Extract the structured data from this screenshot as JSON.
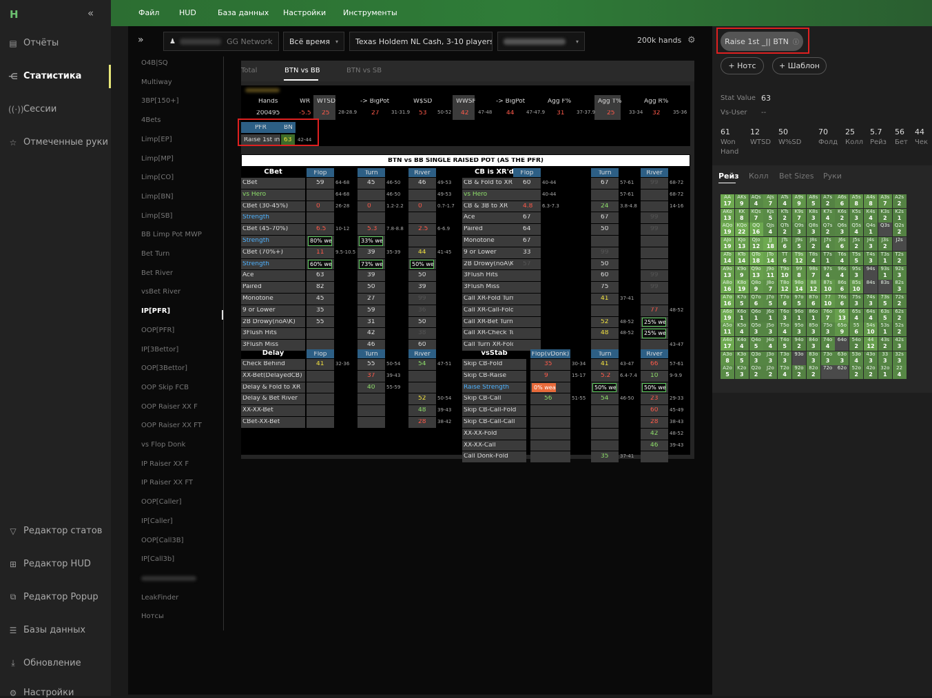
{
  "app": {
    "logo": "H",
    "collapse": "«"
  },
  "nav": [
    {
      "label": "Отчёты",
      "icon": "report-icon",
      "glyph": "▤"
    },
    {
      "label": "Статистика",
      "icon": "stats-icon",
      "glyph": "⋲",
      "active": true
    },
    {
      "label": "Сессии",
      "icon": "sessions-icon",
      "glyph": "((·))"
    },
    {
      "label": "Отмеченные руки",
      "icon": "star-icon",
      "glyph": "☆"
    },
    {
      "label": "Редактор статов",
      "icon": "filter-icon",
      "glyph": "▽"
    },
    {
      "label": "Редактор HUD",
      "icon": "hud-icon",
      "glyph": "⊞"
    },
    {
      "label": "Редактор Popup",
      "icon": "popup-icon",
      "glyph": "⧉"
    },
    {
      "label": "Базы данных",
      "icon": "database-icon",
      "glyph": "☰"
    },
    {
      "label": "Обновление",
      "icon": "download-icon",
      "glyph": "⤓"
    },
    {
      "label": "Настройки",
      "icon": "settings-icon",
      "glyph": "⚙"
    }
  ],
  "menu": [
    "Файл",
    "HUD",
    "База данных",
    "Настройки",
    "Инструменты"
  ],
  "toolbar": {
    "expand": "»",
    "network": "GG Network",
    "time": "Всё время",
    "game": "Texas Holdem NL Cash, 3-10 players",
    "hands": "200k hands"
  },
  "sidelist": [
    "O4B|SQ",
    "Multiway",
    "3BP[150+]",
    "4Bets",
    "Limp[EP]",
    "Limp[MP]",
    "Limp[CO]",
    "Limp[BN]",
    "Limp[SB]",
    "BB Limp Pot MWP",
    "Bet Turn",
    "Bet River",
    "vsBet River",
    "IP[PFR]",
    "OOP[PFR]",
    "IP[3Bettor]",
    "OOP[3Bettor]",
    "OOP Skip FCB",
    "OOP Raiser XX F",
    "OOP Raiser XX FT",
    "vs Flop Donk",
    "IP Raiser XX F",
    "IP Raiser XX FT",
    "OOP[Caller]",
    "IP[Caller]",
    "OOP[Call3B]",
    "IP[Call3b]",
    "",
    "LeakFinder",
    "Нотсы"
  ],
  "tabs": [
    "Total",
    "BTN vs BB",
    "BTN vs SB"
  ],
  "top": {
    "headers": [
      "Hands",
      "WR",
      "WTSD",
      "-> BigPot",
      "W$SD",
      "WWSF",
      "-> BigPot",
      "Agg F%",
      "Agg T%",
      "Agg R%"
    ],
    "vals": [
      "200495",
      "-5.5",
      "25",
      "28-28.9",
      "27",
      "31-31.9",
      "53",
      "50-52",
      "42",
      "47-48",
      "44",
      "47-47.9",
      "31",
      "37-37.9",
      "25",
      "33-34",
      "32",
      "35-36"
    ],
    "pfr": "PFR",
    "bn": "BN",
    "r1": "Raise 1st in",
    "r1v": "63",
    "r1r": "42-44"
  },
  "srp_title": "BTN vs BB SINGLE RAISED POT (AS THE PFR)",
  "streets": [
    "Flop",
    "Turn",
    "River",
    "Flop(vDonk)"
  ],
  "sect": {
    "cbet": "CBet",
    "cbxr": "CB is XR'd",
    "delay": "Delay",
    "vsstab": "vsStab"
  },
  "left_rows": [
    "CBet",
    "vs Hero",
    "CBet (30-45%)",
    "Strength",
    "CBet (45-70%)",
    "Strength",
    "CBet (70%+)",
    "Strength",
    "Ace",
    "Paired",
    "Monotone",
    "9 or Lower",
    "2B Drowy(noA\\K)",
    "3Flush Hits",
    "3Flush Miss"
  ],
  "left_vals": {
    "f": [
      "59",
      "",
      "0",
      "",
      "6.5",
      "80% we",
      "11",
      "60% we",
      "63",
      "82",
      "45",
      "35",
      "55",
      "",
      ""
    ],
    "fr": [
      "64-68",
      "64-68",
      "26-28",
      "",
      "10-12",
      "",
      "9.5-10.5",
      "",
      "",
      "",
      "",
      "",
      "",
      "",
      ""
    ],
    "t": [
      "45",
      "",
      "0",
      "",
      "5.3",
      "33% we",
      "39",
      "73% we",
      "39",
      "50",
      "27",
      "59",
      "31",
      "42",
      "46"
    ],
    "tr": [
      "46-50",
      "46-50",
      "1.2-2.2",
      "",
      "7.8-8.8",
      "",
      "35-39",
      "",
      "",
      "",
      "",
      "",
      "",
      "",
      ""
    ],
    "r": [
      "46",
      "",
      "0",
      "",
      "2.5",
      "",
      "44",
      "50% wea",
      "50",
      "39",
      "99",
      "36",
      "50",
      "38",
      "60"
    ],
    "rr": [
      "49-53",
      "49-53",
      "0.7-1.7",
      "",
      "6-6.9",
      "",
      "41-45",
      "",
      "",
      "",
      "",
      "",
      "",
      "",
      ""
    ]
  },
  "right_rows": [
    "CB & Fold to XR",
    "vs Hero",
    "CB & 3B to XR",
    "Ace",
    "Paired",
    "Monotone",
    "9 or Lower",
    "2B Drowy(noA\\K)",
    "3Flush Hits",
    "3Flush Miss",
    "Call XR-Fold Turn",
    "Call XR-Call-Fold",
    "Call XR-Bet Turn",
    "Call XR-Check Turn",
    "Call Turn XR-Fold"
  ],
  "right_vals": {
    "f": [
      "60",
      "",
      "4.8",
      "67",
      "64",
      "67",
      "33",
      "57",
      "",
      "",
      "",
      "",
      "",
      "",
      ""
    ],
    "fr": [
      "40-44",
      "40-44",
      "6.3-7.3",
      "",
      "",
      "",
      "",
      "",
      "",
      "",
      "",
      "",
      "",
      "",
      ""
    ],
    "t": [
      "67",
      "",
      "24",
      "67",
      "50",
      "",
      "99",
      "50",
      "60",
      "75",
      "41",
      "",
      "52",
      "48",
      ""
    ],
    "tr": [
      "57-61",
      "57-61",
      "3.8-4.8",
      "",
      "",
      "",
      "",
      "",
      "",
      "",
      "37-41",
      "",
      "48-52",
      "48-52",
      ""
    ],
    "r": [
      "99",
      "",
      "",
      "99",
      "99",
      "",
      "",
      "",
      "99",
      "99",
      "",
      "77",
      "25% wea",
      "25% wea",
      ""
    ],
    "rr": [
      "68-72",
      "68-72",
      "14-16",
      "",
      "",
      "",
      "",
      "",
      "",
      "",
      "",
      "48-52",
      "",
      "",
      "43-47"
    ]
  },
  "delay_rows": [
    "Check Behind",
    "XX-Bet(DelayedCB)",
    "Delay & Fold to XR",
    "Delay & Bet River",
    "XX-XX-Bet",
    "CBet-XX-Bet"
  ],
  "delay_vals": {
    "f": [
      "41",
      "",
      "",
      "",
      "",
      ""
    ],
    "fr": [
      "32-36",
      "",
      "",
      "",
      "",
      ""
    ],
    "t": [
      "55",
      "37",
      "40",
      "",
      "",
      ""
    ],
    "tr": [
      "50-54",
      "39-43",
      "55-59",
      "",
      "",
      ""
    ],
    "r": [
      "54",
      "",
      "",
      "52",
      "48",
      "28"
    ],
    "rr": [
      "47-51",
      "",
      "",
      "50-54",
      "39-43",
      "38-42"
    ]
  },
  "stab_rows": [
    "Skip CB-Fold",
    "Skip CB-Raise",
    "Raise Strength",
    "Skip CB-Call",
    "Skip CB-Call-Fold",
    "Skip CB-Call-Call",
    "XX-XX-Fold",
    "XX-XX-Call",
    "Call Donk-Fold"
  ],
  "stab_vals": {
    "f": [
      "35",
      "9",
      "0% weak",
      "56",
      "",
      "",
      "",
      "",
      ""
    ],
    "fr": [
      "30-34",
      "15-17",
      "",
      "51-55",
      "",
      "",
      "",
      "",
      ""
    ],
    "t": [
      "41",
      "5.2",
      "50% we",
      "54",
      "",
      "",
      "",
      "",
      "35"
    ],
    "tr": [
      "43-47",
      "6.4-7.4",
      "",
      "46-50",
      "",
      "",
      "",
      "",
      "37-41"
    ],
    "r": [
      "66",
      "10",
      "50% wea",
      "23",
      "60",
      "28",
      "42",
      "46",
      ""
    ],
    "rr": [
      "57-61",
      "9-9.9",
      "",
      "29-33",
      "45-49",
      "38-43",
      "48-52",
      "39-43",
      ""
    ]
  },
  "rp": {
    "stat_btn": "Raise 1st _|| BTN",
    "notes": "+ Нотс",
    "template": "+ Шаблон",
    "stat_value_label": "Stat Value",
    "stat_value": "63",
    "vs_user_label": "Vs-User",
    "vs_user": "--",
    "stats": [
      {
        "v": "61",
        "l": "Won Hand"
      },
      {
        "v": "12",
        "l": "WTSD"
      },
      {
        "v": "50",
        "l": "W%SD"
      },
      {
        "v": "70",
        "l": "Фолд"
      },
      {
        "v": "25",
        "l": "Колл"
      },
      {
        "v": "5.7",
        "l": "Рейз"
      },
      {
        "v": "56",
        "l": "Бет"
      },
      {
        "v": "44",
        "l": "Чек"
      }
    ],
    "tabs": [
      "Рейз",
      "Колл",
      "Bet Sizes",
      "Руки"
    ]
  },
  "grid": {
    "rows": [
      "AA 17|AKs 9|AQs 4|AJs 7|ATs 4|A9s 9|A8s 5|A7s 2|A6s 6|A5s 8|A4s 8|A3s 7|A2s 2",
      "AKo 13|KK 8|KQs 7|KJs 5|KTs 2|K9s 7|K8s 3|K7s 4|K6s 2|K5s 3|K4s 4|K3s 2|K2s 1",
      "AQo 19|KQo 22|QQ 16|QJs 4|QTs 2|Q9s 3|Q8s 3|Q7s 2|Q6s 3|Q5s 4|Q4s 1|Q3s |Q2s 2",
      "AJo 19|KJo 13|QJo 12|JJ 18|JTs 6|J9s 5|J8s 2|J7s 4|J6s 6|J5s 2|J4s 3|J3s 2|J2s ",
      "ATo 14|KTo 14|QTo 18|JTo 14|TT 6|T9s 12|T8s 4|T7s 1|T6s 4|T5s 5|T4s 3|T3s 1|T2s 2",
      "A9o 13|K9o 9|Q9o 13|J9o 11|T9o 10|99 8|98s 7|97s 4|96s 4|95s 3|94s |93s 1|92s 3",
      "A8o 16|K8o 19|Q8o 9|J8o 7|T8o 12|98o 14|88 12|87s 10|86s 6|85s 10|84s |83s |82s 3",
      "A7o 16|K7o 5|Q7o 6|J7o 5|T7o 6|97o 5|87o 6|77 10|76s 6|75s 3|74s 3|73s 5|72s 2",
      "A6o 19|K6o 1|Q6o 1|J6o 1|T6o 3|96o 1|86o 1|76o 7|66 13|65s 4|64s 4|63s 5|62s 2",
      "A5o 11|K5o 4|Q5o 3|J5o 3|T5o 4|95o 3|85o 3|75o 3|65o 9|55 6|54s 10|53s 1|52s 2",
      "A4o 17|K4o 4|Q4o 5|J4o 4|T4o 5|94o 2|84o 3|74o 4|64o |54o 2|44 12|43s 2|42s 3",
      "A3o 8|K3o 5|Q3o 3|J3o 3|T3o 3|93o |83o 3|73o 3|63o 3|53o 4|43o 3|33 3|32s 3",
      "A2o 5|K2o 3|Q2o 2|J2o 2|T2o 4|92o 2|82o 2|72o |62o |52o 2|42o 2|32o 1|22 4"
    ]
  }
}
